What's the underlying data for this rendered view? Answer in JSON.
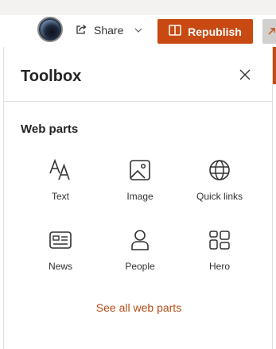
{
  "header": {
    "share_label": "Share",
    "republish_label": "Republish"
  },
  "toolbox": {
    "title": "Toolbox",
    "section_title": "Web parts",
    "web_parts": [
      {
        "label": "Text",
        "icon": "text-icon"
      },
      {
        "label": "Image",
        "icon": "image-icon"
      },
      {
        "label": "Quick links",
        "icon": "globe-icon"
      },
      {
        "label": "News",
        "icon": "news-icon"
      },
      {
        "label": "People",
        "icon": "person-icon"
      },
      {
        "label": "Hero",
        "icon": "hero-grid-icon"
      }
    ],
    "see_all_label": "See all web parts"
  },
  "colors": {
    "accent": "#c84a12",
    "link": "#b84b16"
  }
}
